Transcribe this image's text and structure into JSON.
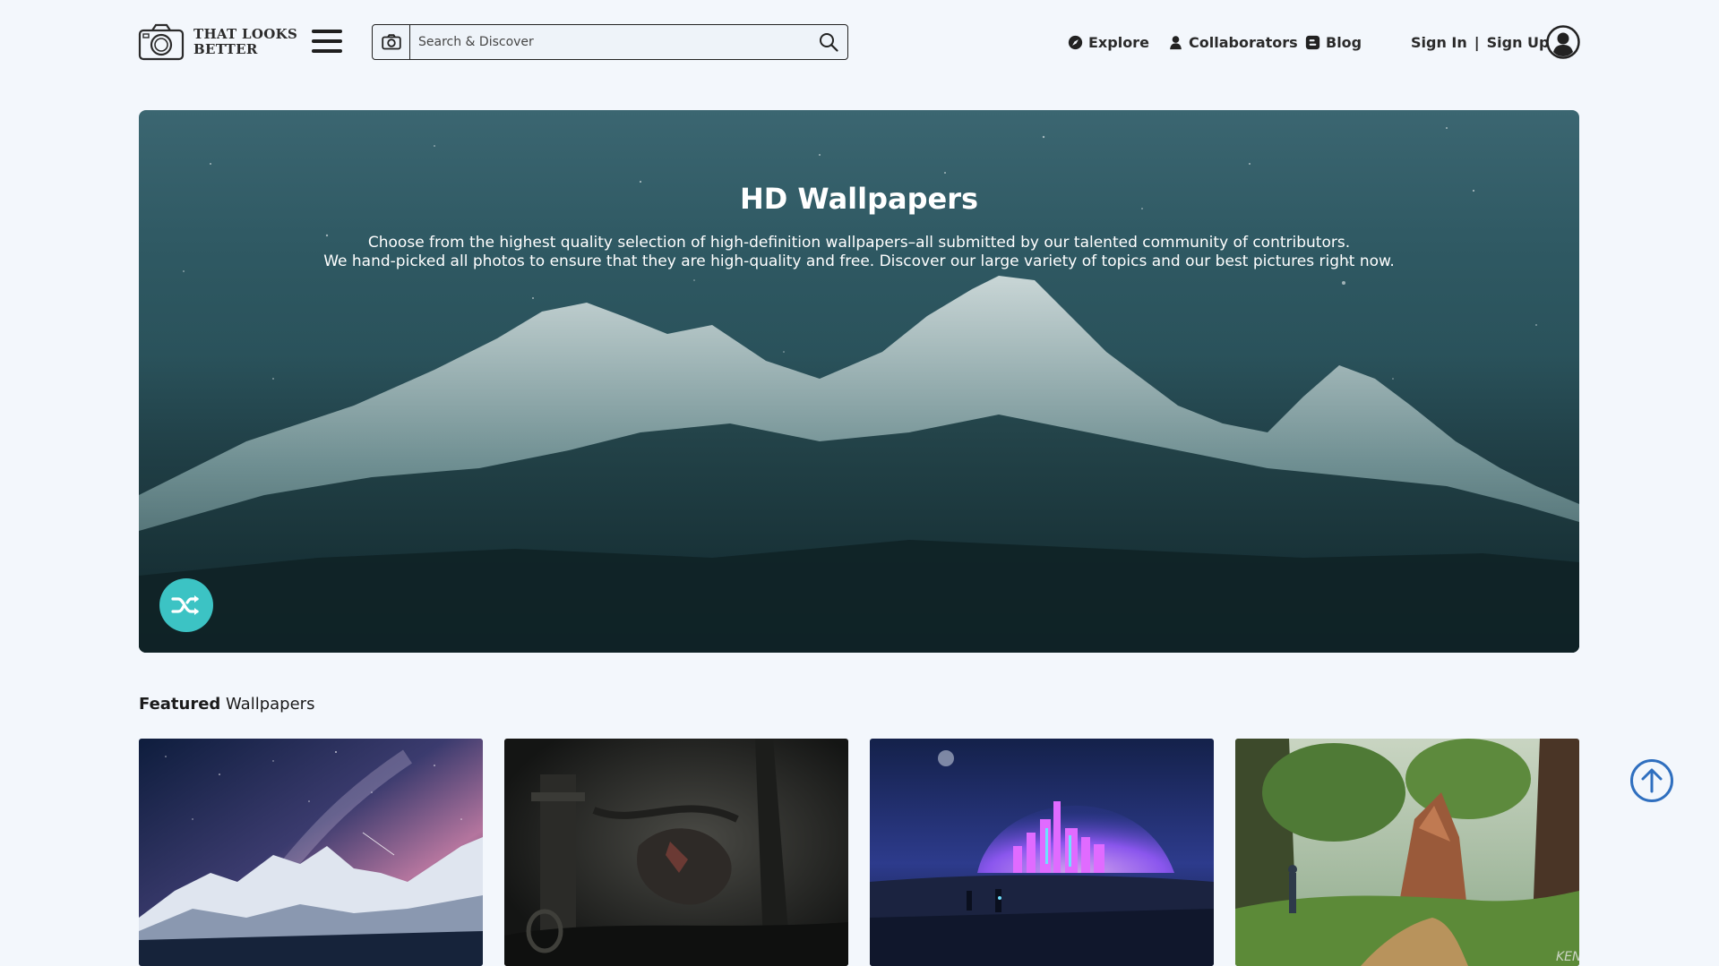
{
  "header": {
    "logo": {
      "line1": "THAT LOOKS",
      "line2": "BETTER",
      "icon": "camera-icon"
    },
    "menu_icon": "hamburger-icon",
    "search": {
      "placeholder": "Search & Discover",
      "value": "",
      "left_icon": "camera-icon",
      "right_icon": "search-icon"
    },
    "nav": [
      {
        "label": "Explore",
        "icon": "compass-icon"
      },
      {
        "label": "Collaborators",
        "icon": "user-icon"
      },
      {
        "label": "Blog",
        "icon": "blogger-icon"
      }
    ],
    "auth": {
      "sign_in": "Sign In",
      "separator": "|",
      "sign_up": "Sign Up"
    },
    "avatar_icon": "user-circle-icon"
  },
  "hero": {
    "title": "HD Wallpapers",
    "description_line1": "Choose from the highest quality selection of high-definition wallpapers–all submitted by our talented community of contributors.",
    "description_line2": "We hand-picked all photos to ensure that they are high-quality and free. Discover our large variety of topics and our best pictures right now.",
    "shuffle_icon": "shuffle-icon",
    "accent_color": "#3cc3c4"
  },
  "featured": {
    "title_bold": "Featured",
    "title_rest": " Wallpapers",
    "items": [
      {
        "subject": "night-sky-mountains"
      },
      {
        "subject": "dark-forest-creature"
      },
      {
        "subject": "neon-dome-city"
      },
      {
        "subject": "fantasy-forest",
        "watermark": "KEN"
      }
    ]
  },
  "scroll_top_icon": "arrow-up-circle-icon"
}
